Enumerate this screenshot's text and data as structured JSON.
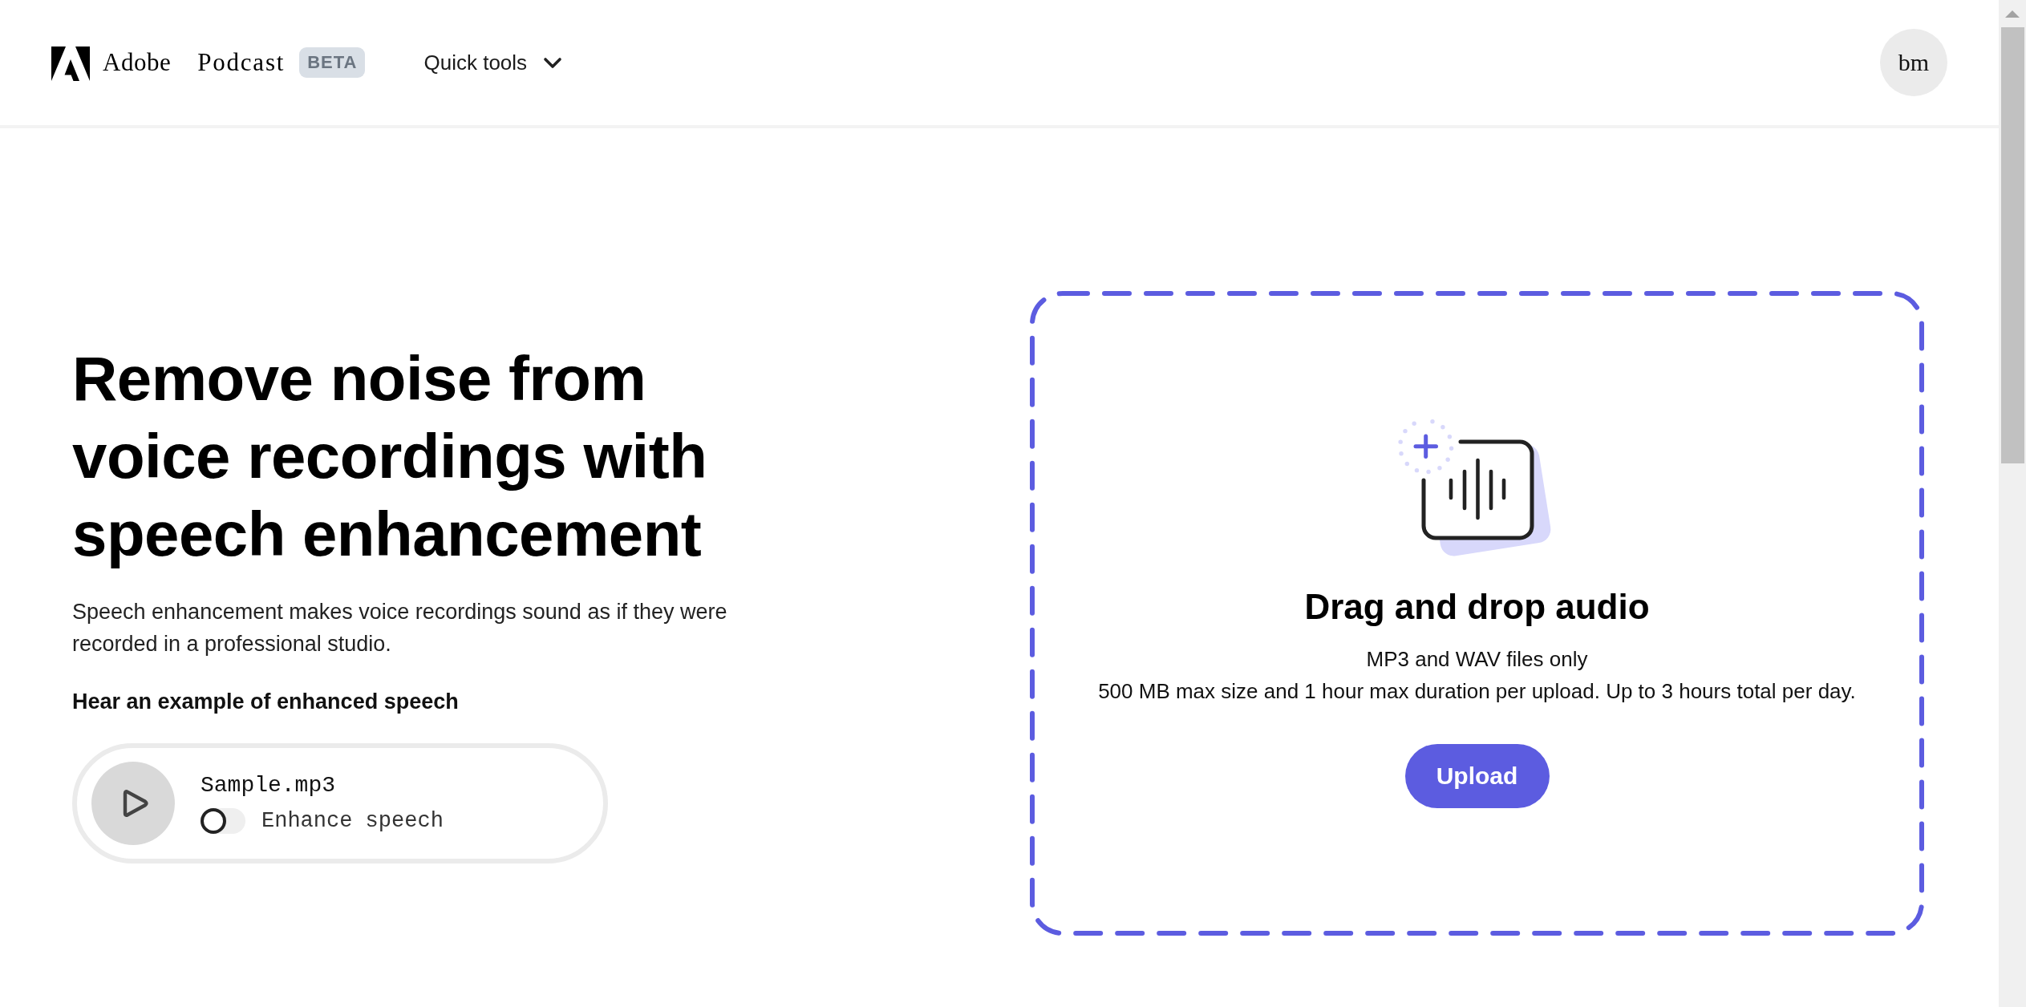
{
  "header": {
    "brand": "Adobe",
    "product": "Podcast",
    "badge": "BETA",
    "menu": {
      "label": "Quick tools",
      "expanded": false
    },
    "avatar": "bm"
  },
  "hero": {
    "title": "Remove noise from voice recordings with speech enhancement",
    "description": "Speech enhancement makes voice recordings sound as if they were recorded in a professional studio.",
    "example_label": "Hear an example of enhanced speech",
    "player": {
      "file_name": "Sample.mp3",
      "playing": false,
      "enhance": {
        "label": "Enhance speech",
        "on": false
      }
    }
  },
  "upload": {
    "title": "Drag and drop audio",
    "formats": "MP3 and WAV files only",
    "limits": "500 MB max size and 1 hour max duration per upload. Up to 3 hours total per day.",
    "button": "Upload"
  }
}
